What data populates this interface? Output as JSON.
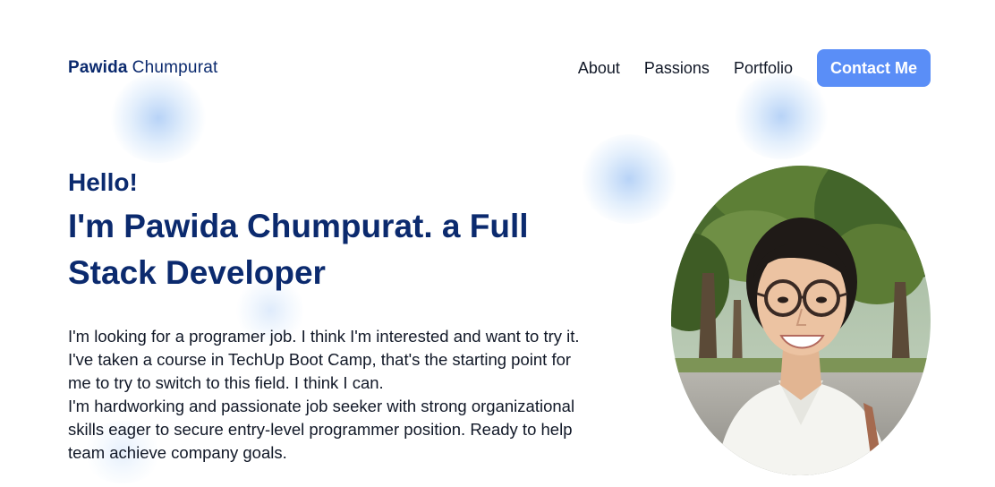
{
  "nav": {
    "brand_first": "Pawida",
    "brand_last": "Chumpurat",
    "links": [
      "About",
      "Passions",
      "Portfolio"
    ],
    "cta": "Contact Me"
  },
  "hero": {
    "greeting": "Hello!",
    "headline": "I'm Pawida Chumpurat. a Full Stack Developer",
    "bio_1": "I'm looking for a programer job. I think I'm interested and want to try it. I've taken a course in TechUp Boot Camp, that's the starting point for me to try to switch to this field. I think I can.",
    "bio_2": "I'm hardworking and passionate job seeker with strong organizational skills eager to secure entry-level programmer position. Ready to help team achieve company goals.",
    "photo_icon": "profile-photo"
  },
  "colors": {
    "brand": "#0b2a6e",
    "cta": "#5a8ef7",
    "text": "#111827"
  }
}
